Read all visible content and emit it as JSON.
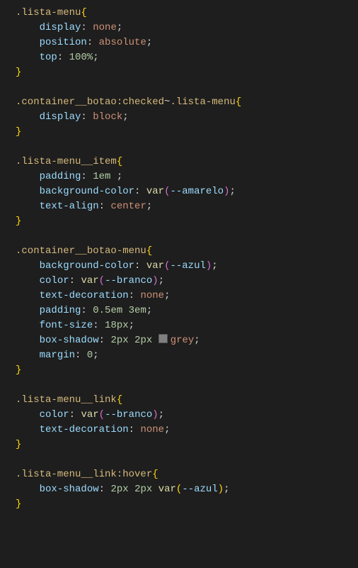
{
  "code": {
    "rules": [
      {
        "selector_parts": [
          {
            "t": ".lista-menu",
            "c": "sel-yellow"
          }
        ],
        "decls": [
          {
            "prop": "display",
            "value_parts": [
              {
                "t": "none",
                "c": "value-kw"
              }
            ]
          },
          {
            "prop": "position",
            "value_parts": [
              {
                "t": "absolute",
                "c": "value-kw"
              }
            ]
          },
          {
            "prop": "top",
            "value_parts": [
              {
                "t": "100%",
                "c": "num"
              }
            ]
          }
        ],
        "brace_c": "brace"
      },
      {
        "selector_parts": [
          {
            "t": ".container__botao",
            "c": "sel-yellow"
          },
          {
            "t": ":checked",
            "c": "sel-yellow"
          },
          {
            "t": "~",
            "c": "punct"
          },
          {
            "t": ".lista-menu",
            "c": "sel-yellow"
          }
        ],
        "decls": [
          {
            "prop": "display",
            "value_parts": [
              {
                "t": "block",
                "c": "value-kw"
              }
            ]
          }
        ],
        "brace_c": "brace"
      },
      {
        "selector_parts": [
          {
            "t": ".lista-menu__item",
            "c": "sel-yellow"
          }
        ],
        "decls": [
          {
            "prop": "padding",
            "value_parts": [
              {
                "t": "1em",
                "c": "num"
              }
            ],
            "trailing_space": true
          },
          {
            "prop": "background-color",
            "value_parts": [
              {
                "t": "var",
                "c": "func"
              },
              {
                "t": "(",
                "c": "brace-pink"
              },
              {
                "t": "--amarelo",
                "c": "var"
              },
              {
                "t": ")",
                "c": "brace-pink"
              }
            ]
          },
          {
            "prop": "text-align",
            "value_parts": [
              {
                "t": "center",
                "c": "value-kw"
              }
            ]
          }
        ],
        "brace_c": "brace"
      },
      {
        "selector_parts": [
          {
            "t": ".container__botao-menu",
            "c": "sel-yellow"
          }
        ],
        "decls": [
          {
            "prop": "background-color",
            "value_parts": [
              {
                "t": "var",
                "c": "func"
              },
              {
                "t": "(",
                "c": "brace-pink"
              },
              {
                "t": "--azul",
                "c": "var"
              },
              {
                "t": ")",
                "c": "brace-pink"
              }
            ]
          },
          {
            "prop": "color",
            "value_parts": [
              {
                "t": "var",
                "c": "func"
              },
              {
                "t": "(",
                "c": "brace-pink"
              },
              {
                "t": "--branco",
                "c": "var"
              },
              {
                "t": ")",
                "c": "brace-pink"
              }
            ]
          },
          {
            "prop": "text-decoration",
            "value_parts": [
              {
                "t": "none",
                "c": "value-kw"
              }
            ]
          },
          {
            "prop": "padding",
            "value_parts": [
              {
                "t": "0.5em",
                "c": "num"
              },
              {
                "t": " ",
                "c": "punct"
              },
              {
                "t": "3em",
                "c": "num"
              }
            ]
          },
          {
            "prop": "font-size",
            "value_parts": [
              {
                "t": "18px",
                "c": "num"
              }
            ]
          },
          {
            "prop": "box-shadow",
            "swatch": true,
            "value_parts": [
              {
                "t": "2px",
                "c": "num"
              },
              {
                "t": " ",
                "c": "punct"
              },
              {
                "t": "2px",
                "c": "num"
              },
              {
                "t": " ",
                "c": "punct"
              },
              {
                "t": "grey",
                "c": "value-kw"
              }
            ]
          },
          {
            "prop": "margin",
            "value_parts": [
              {
                "t": "0",
                "c": "num"
              }
            ]
          }
        ],
        "brace_c": "brace"
      },
      {
        "selector_parts": [
          {
            "t": ".lista-menu__link",
            "c": "sel-yellow"
          }
        ],
        "decls": [
          {
            "prop": "color",
            "value_parts": [
              {
                "t": "var",
                "c": "func"
              },
              {
                "t": "(",
                "c": "brace-pink"
              },
              {
                "t": "--branco",
                "c": "var"
              },
              {
                "t": ")",
                "c": "brace-pink"
              }
            ]
          },
          {
            "prop": "text-decoration",
            "value_parts": [
              {
                "t": "none",
                "c": "value-kw"
              }
            ]
          }
        ],
        "brace_c": "brace"
      },
      {
        "selector_parts": [
          {
            "t": ".lista-menu__link",
            "c": "sel-yellow"
          },
          {
            "t": ":hover",
            "c": "sel-yellow"
          }
        ],
        "decls": [
          {
            "prop": "box-shadow",
            "value_parts": [
              {
                "t": "2px",
                "c": "num"
              },
              {
                "t": " ",
                "c": "punct"
              },
              {
                "t": "2px",
                "c": "num"
              },
              {
                "t": " ",
                "c": "punct"
              },
              {
                "t": "var",
                "c": "func"
              },
              {
                "t": "(",
                "c": "brace"
              },
              {
                "t": "--azul",
                "c": "var"
              },
              {
                "t": ")",
                "c": "brace"
              }
            ]
          }
        ],
        "brace_c": "brace"
      }
    ]
  }
}
